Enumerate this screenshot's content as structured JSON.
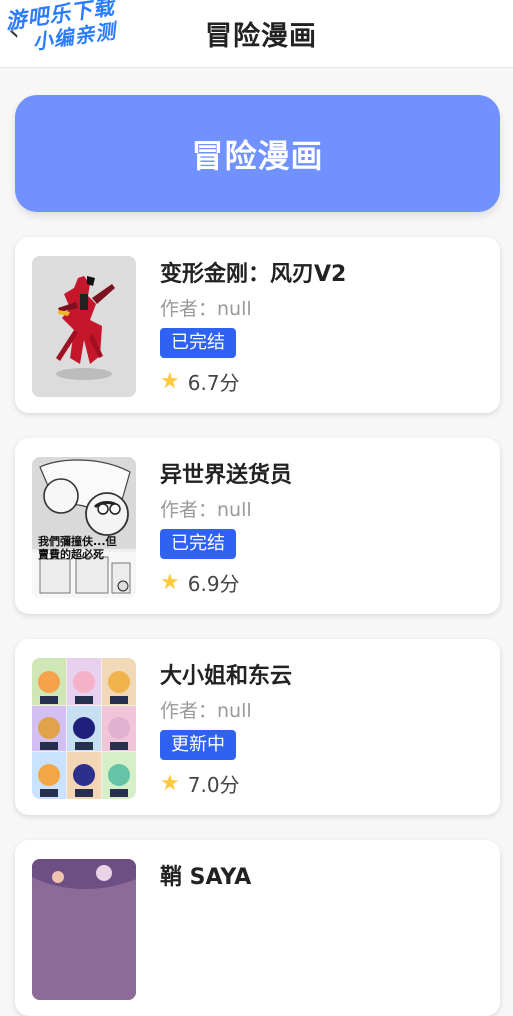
{
  "header": {
    "watermark_line1": "游吧乐下载",
    "watermark_line2": "小编亲测",
    "title": "冒险漫画"
  },
  "banner": {
    "title": "冒险漫画"
  },
  "comics": [
    {
      "title": "变形金刚：风刃V2",
      "author": "作者：null",
      "status": "已完结",
      "rating": "6.7分"
    },
    {
      "title": "异世界送货员",
      "author": "作者：null",
      "status": "已完结",
      "rating": "6.9分"
    },
    {
      "title": "大小姐和东云",
      "author": "作者：null",
      "status": "更新中",
      "rating": "7.0分"
    },
    {
      "title": "鞘 SAYA"
    }
  ],
  "icons": {
    "back": "chevron-left-icon",
    "star": "star-icon"
  },
  "colors": {
    "banner": "#7191ff",
    "badge": "#2f62f3",
    "star": "#ffc83d"
  },
  "cover_texts": {
    "comic_2": "我們彌撞伕...但賣費的超必死"
  }
}
